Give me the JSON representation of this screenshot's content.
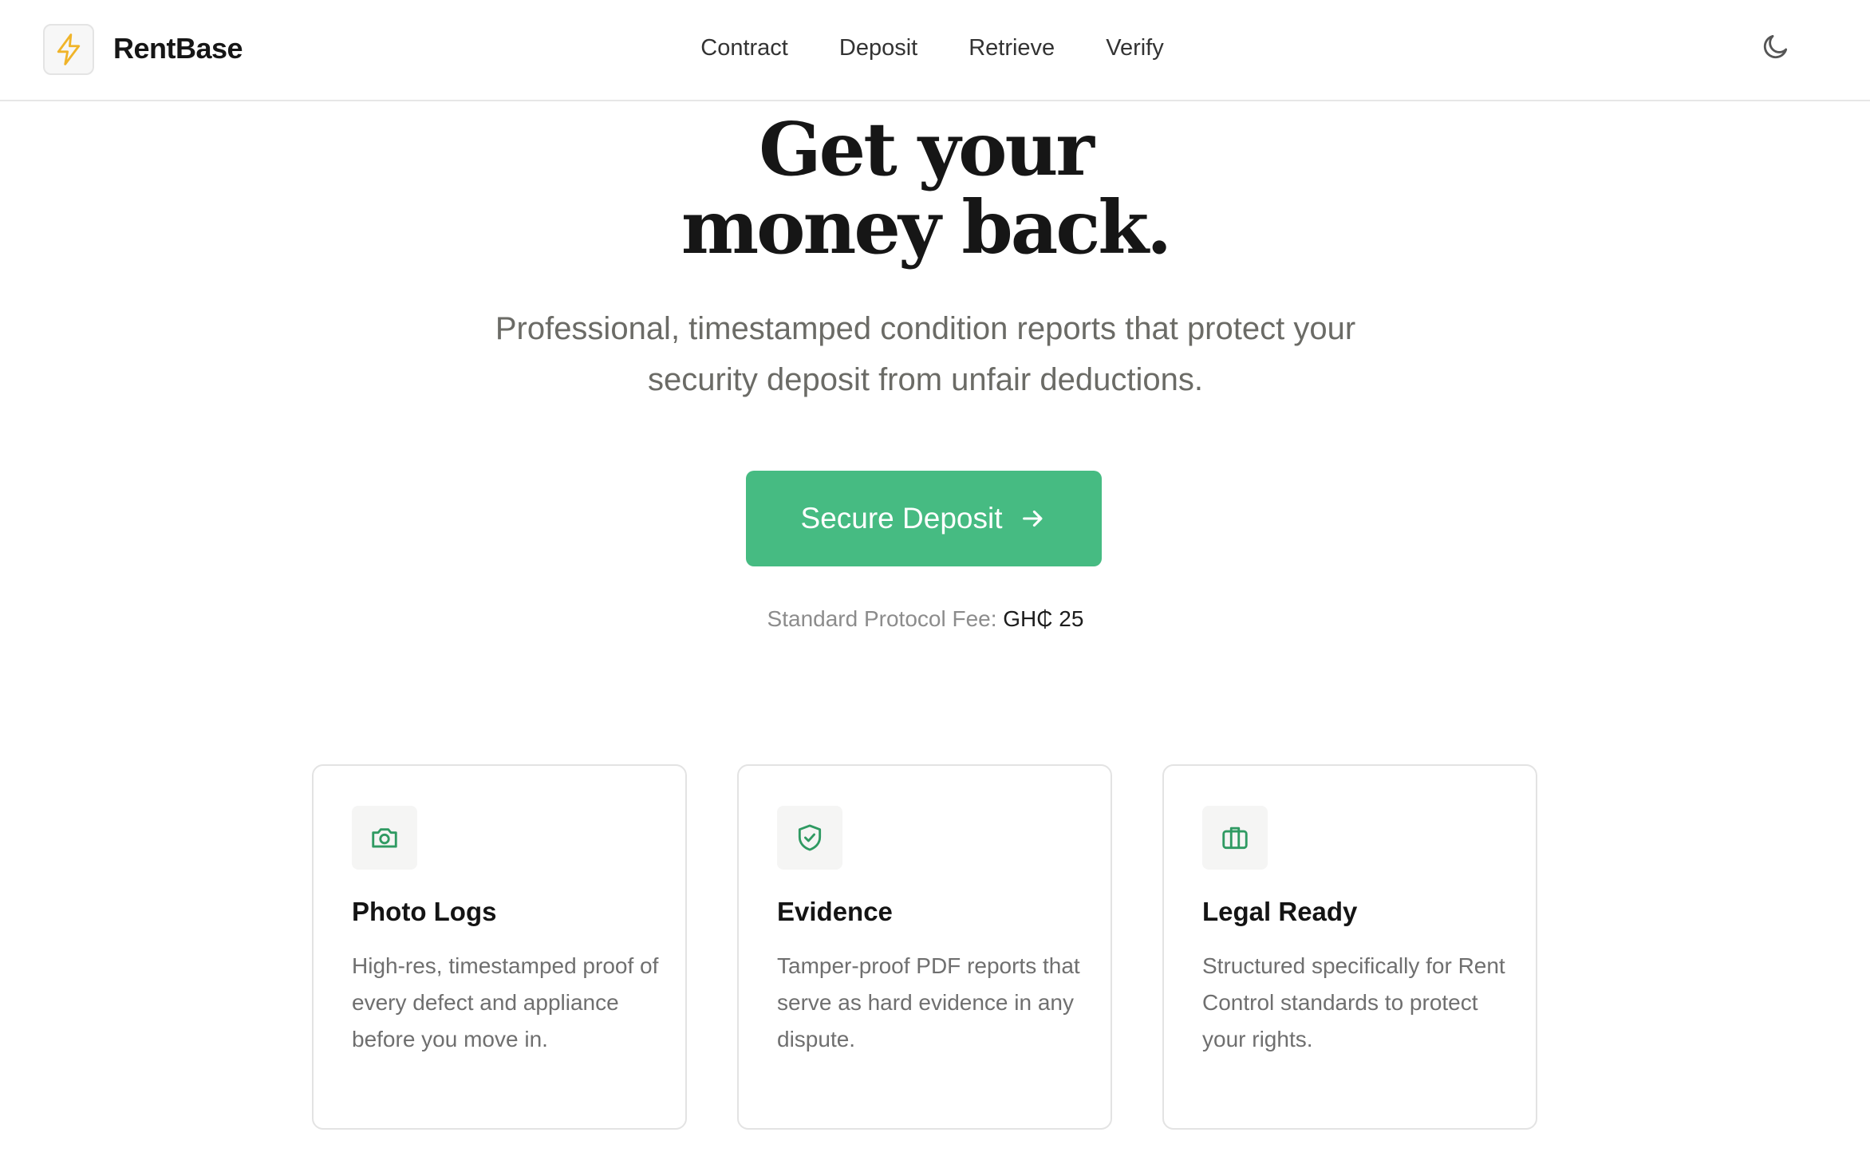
{
  "header": {
    "brand": "RentBase",
    "logo_icon": "lightning-bolt-icon",
    "nav": [
      "Contract",
      "Deposit",
      "Retrieve",
      "Verify"
    ],
    "theme_icon": "moon-icon"
  },
  "hero": {
    "title_line1": "Get your",
    "title_line2": "money back.",
    "subtitle": "Professional, timestamped condition reports that protect your security deposit from unfair deductions.",
    "cta_label": "Secure Deposit",
    "cta_icon": "arrow-right-icon",
    "fee_label": "Standard Protocol Fee:",
    "fee_value": "GH₵ 25"
  },
  "features": [
    {
      "icon": "camera-icon",
      "title": "Photo Logs",
      "description": "High-res, timestamped proof of every defect and appliance before you move in."
    },
    {
      "icon": "shield-check-icon",
      "title": "Evidence",
      "description": "Tamper-proof PDF reports that serve as hard evidence in any dispute."
    },
    {
      "icon": "briefcase-icon",
      "title": "Legal Ready",
      "description": "Structured specifically for Rent Control standards to protect your rights."
    }
  ],
  "colors": {
    "accent": "#46bb82",
    "icon_green": "#2f9a62",
    "logo_bolt": "#f0b429"
  }
}
